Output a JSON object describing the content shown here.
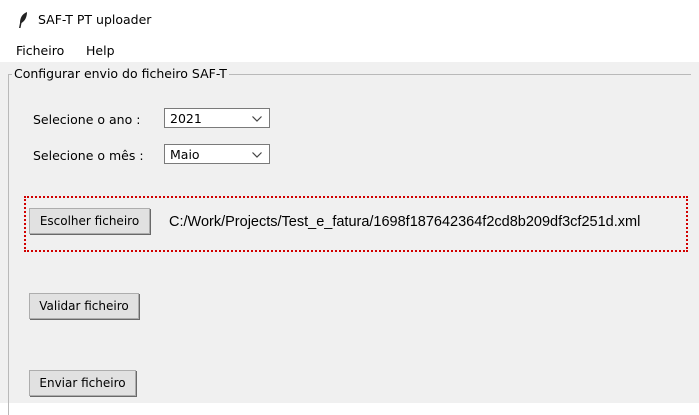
{
  "window": {
    "title": "SAF-T PT uploader",
    "icon": "feather-icon"
  },
  "menu": {
    "items": [
      "Ficheiro",
      "Help"
    ]
  },
  "frame": {
    "label": "Configurar envio do ficheiro SAF-T"
  },
  "year": {
    "label": "Selecione o ano :",
    "value": "2021"
  },
  "month": {
    "label": "Selecione o mês :",
    "value": "Maio"
  },
  "file": {
    "button_label": "Escolher ficheiro",
    "path": "C:/Work/Projects/Test_e_fatura/1698f187642364f2cd8b209df3cf251d.xml"
  },
  "actions": {
    "validate_label": "Validar ficheiro",
    "send_label": "Enviar ficheiro"
  },
  "colors": {
    "highlight_border": "#d10000",
    "content_background": "#f0f0f0"
  }
}
